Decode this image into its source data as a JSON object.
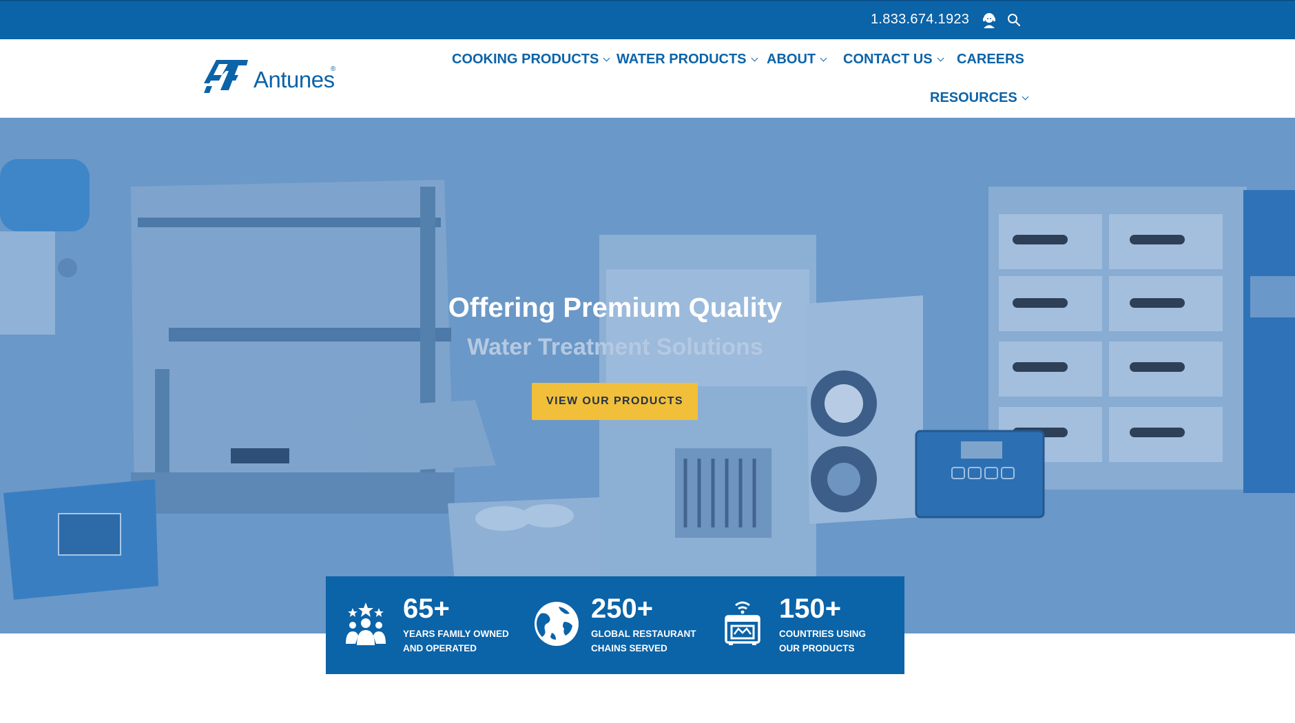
{
  "topbar": {
    "phone": "1.833.674.1923",
    "icons": [
      "user-support-icon",
      "search-icon"
    ],
    "background": "#0b63a8"
  },
  "header": {
    "logo_text": "Antunes",
    "nav": [
      {
        "label": "COOKING PRODUCTS",
        "dropdown": true
      },
      {
        "label": "WATER PRODUCTS",
        "dropdown": true
      },
      {
        "label": "ABOUT",
        "dropdown": true
      },
      {
        "label": "CONTACT US",
        "dropdown": true
      },
      {
        "label": "CAREERS",
        "dropdown": false
      },
      {
        "label": "RESOURCES",
        "dropdown": true
      }
    ],
    "accent": "#0b63a8"
  },
  "hero": {
    "title": "Offering Premium Quality",
    "subtitle": "Water Treatment Solutions",
    "cta_label": "VIEW OUR PRODUCTS",
    "cta_color": "#f1bf3a",
    "overlay_color": "#6a98c8"
  },
  "stats": [
    {
      "icon": "family-icon",
      "number": "65+",
      "label_line1": "YEARS FAMILY OWNED",
      "label_line2": "AND OPERATED"
    },
    {
      "icon": "globe-icon",
      "number": "250+",
      "label_line1": "GLOBAL RESTAURANT",
      "label_line2": "CHAINS SERVED"
    },
    {
      "icon": "kitchen-appliance-icon",
      "number": "150+",
      "label_line1": "COUNTRIES USING",
      "label_line2": "OUR PRODUCTS"
    }
  ]
}
